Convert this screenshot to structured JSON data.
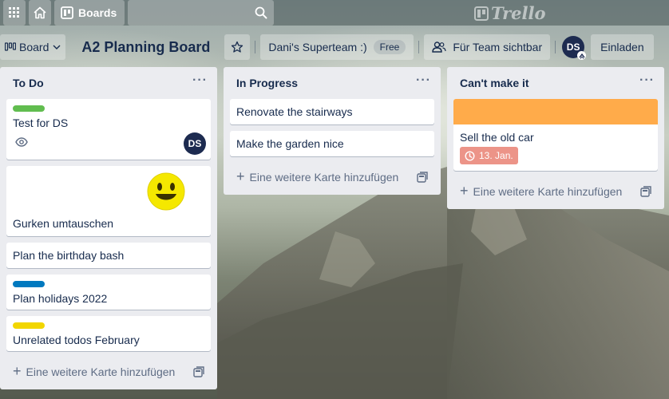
{
  "header": {
    "apps_icon": "grid-icon",
    "home_icon": "home-icon",
    "boards_label": "Boards",
    "search_icon": "search-icon",
    "logo_text": "Trello"
  },
  "boardbar": {
    "view_label": "Board",
    "board_title": "A2 Planning Board",
    "team_label": "Dani's Superteam :)",
    "team_badge": "Free",
    "visibility_label": "Für Team sichtbar",
    "member_initials": "DS",
    "invite_label": "Einladen"
  },
  "lists": [
    {
      "title": "To Do",
      "menu": "···",
      "add_card": "Eine weitere Karte hinzufügen",
      "cards": [
        {
          "title": "Test for DS",
          "label_color": "#61bd4f",
          "member": "DS"
        },
        {
          "title": "Gurken umtauschen",
          "sticker": "smiley-sticker"
        },
        {
          "title": "Plan the birthday bash"
        },
        {
          "title": "Plan holidays 2022",
          "label_color": "#0079bf"
        },
        {
          "title": "Unrelated todos February",
          "label_color": "#f2d600"
        }
      ]
    },
    {
      "title": "In Progress",
      "menu": "···",
      "add_card": "Eine weitere Karte hinzufügen",
      "cards": [
        {
          "title": "Renovate the stairways"
        },
        {
          "title": "Make the garden nice"
        }
      ]
    },
    {
      "title": "Can't make it",
      "menu": "···",
      "add_card": "Eine weitere Karte hinzufügen",
      "cards": [
        {
          "title": "Sell the old car",
          "cover_color": "#ffab4a",
          "due": "13. Jan.",
          "due_color": "#ec9488"
        }
      ]
    }
  ]
}
